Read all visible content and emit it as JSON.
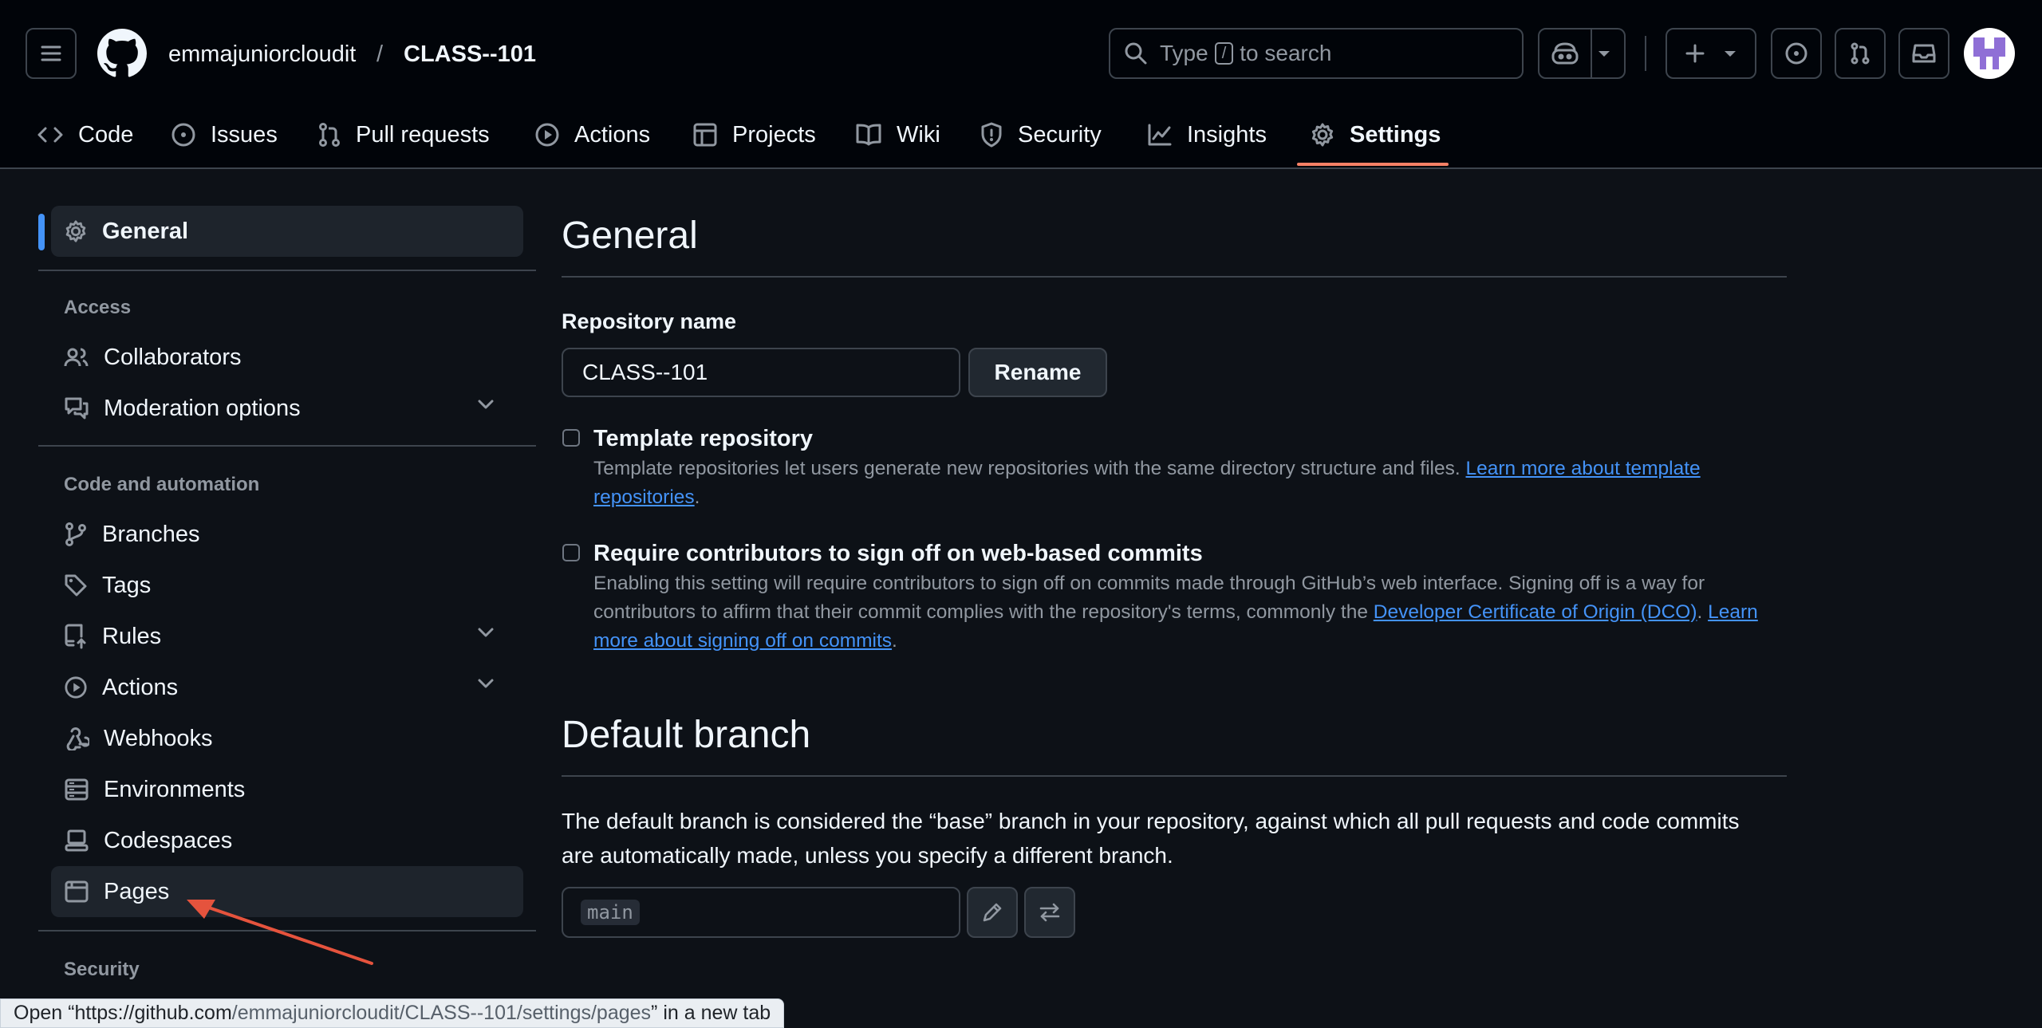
{
  "header": {
    "owner": "emmajuniorcloudit",
    "separator": "/",
    "repo": "CLASS--101",
    "search": {
      "prefix": "Type",
      "key": "/",
      "suffix": "to search"
    }
  },
  "tabs": [
    {
      "label": "Code",
      "icon": "code-icon"
    },
    {
      "label": "Issues",
      "icon": "issue-icon"
    },
    {
      "label": "Pull requests",
      "icon": "pull-request-icon"
    },
    {
      "label": "Actions",
      "icon": "play-icon"
    },
    {
      "label": "Projects",
      "icon": "table-icon"
    },
    {
      "label": "Wiki",
      "icon": "book-icon"
    },
    {
      "label": "Security",
      "icon": "shield-icon"
    },
    {
      "label": "Insights",
      "icon": "graph-icon"
    },
    {
      "label": "Settings",
      "icon": "gear-icon",
      "active": true
    }
  ],
  "sidebar": {
    "general": "General",
    "access_heading": "Access",
    "access_items": [
      "Collaborators",
      "Moderation options"
    ],
    "code_heading": "Code and automation",
    "code_items": [
      "Branches",
      "Tags",
      "Rules",
      "Actions",
      "Webhooks",
      "Environments",
      "Codespaces",
      "Pages"
    ],
    "security_heading": "Security"
  },
  "main": {
    "title": "General",
    "repo_name_label": "Repository name",
    "repo_name_value": "CLASS--101",
    "rename_button": "Rename",
    "template": {
      "title": "Template repository",
      "desc": "Template repositories let users generate new repositories with the same directory structure and files.",
      "link": "Learn more about template repositories"
    },
    "signoff": {
      "title": "Require contributors to sign off on web-based commits",
      "desc": "Enabling this setting will require contributors to sign off on commits made through GitHub’s web interface. Signing off is a way for contributors to affirm that their commit complies with the repository's terms, commonly the",
      "dco_link": "Developer Certificate of Origin (DCO)",
      "learn_link": "Learn more about signing off on commits"
    },
    "default_branch": {
      "title": "Default branch",
      "desc": "The default branch is considered the “base” branch in your repository, against which all pull requests and code commits are automatically made, unless you specify a different branch.",
      "value": "main"
    }
  },
  "status_bar": {
    "prefix": "Open “",
    "url_host": "https://github.com",
    "url_path": "/emmajuniorcloudit/CLASS--101/settings/pages",
    "suffix": "” in a new tab"
  },
  "colors": {
    "background": "#0d1117",
    "header": "#010409",
    "accent_blue": "#4493f8",
    "tab_underline": "#f78166",
    "annotation_arrow": "#e5533d"
  }
}
